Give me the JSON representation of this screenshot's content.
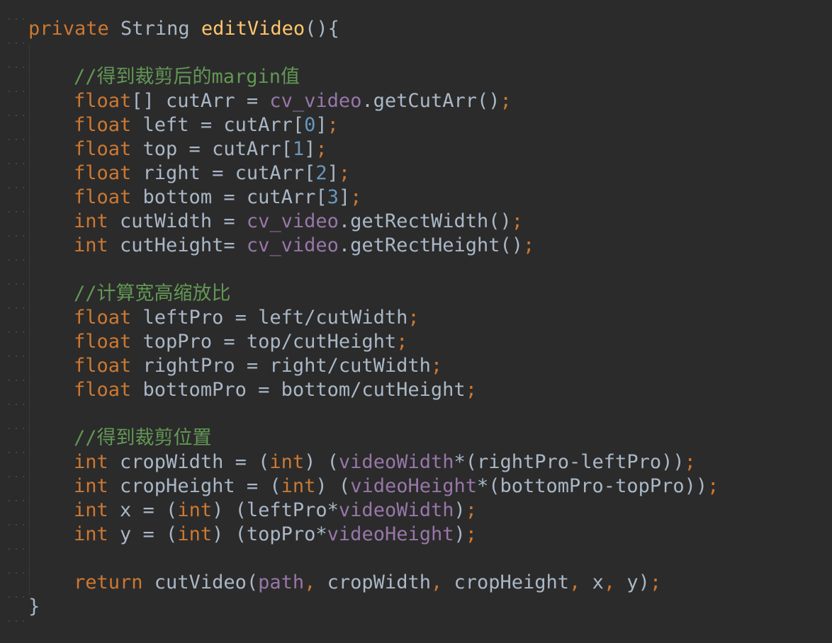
{
  "code_lines": [
    {
      "indent": 0,
      "tokens": [
        [
          "kw",
          "private"
        ],
        [
          "pl",
          " String "
        ],
        [
          "fn",
          "editVideo"
        ],
        [
          "pl",
          "(){"
        ]
      ]
    },
    {
      "indent": 0,
      "tokens": []
    },
    {
      "indent": 1,
      "tokens": [
        [
          "cm",
          "//得到裁剪后的margin值"
        ]
      ]
    },
    {
      "indent": 1,
      "tokens": [
        [
          "kw",
          "float"
        ],
        [
          "pl",
          "[] cutArr = "
        ],
        [
          "fd",
          "cv_video"
        ],
        [
          "pl",
          ".getCutArr()"
        ],
        [
          "kw",
          ";"
        ]
      ]
    },
    {
      "indent": 1,
      "tokens": [
        [
          "kw",
          "float"
        ],
        [
          "pl",
          " left = cutArr["
        ],
        [
          "nm",
          "0"
        ],
        [
          "pl",
          "]"
        ],
        [
          "kw",
          ";"
        ]
      ]
    },
    {
      "indent": 1,
      "tokens": [
        [
          "kw",
          "float"
        ],
        [
          "pl",
          " top = cutArr["
        ],
        [
          "nm",
          "1"
        ],
        [
          "pl",
          "]"
        ],
        [
          "kw",
          ";"
        ]
      ]
    },
    {
      "indent": 1,
      "tokens": [
        [
          "kw",
          "float"
        ],
        [
          "pl",
          " right = cutArr["
        ],
        [
          "nm",
          "2"
        ],
        [
          "pl",
          "]"
        ],
        [
          "kw",
          ";"
        ]
      ]
    },
    {
      "indent": 1,
      "tokens": [
        [
          "kw",
          "float"
        ],
        [
          "pl",
          " bottom = cutArr["
        ],
        [
          "nm",
          "3"
        ],
        [
          "pl",
          "]"
        ],
        [
          "kw",
          ";"
        ]
      ]
    },
    {
      "indent": 1,
      "tokens": [
        [
          "kw",
          "int"
        ],
        [
          "pl",
          " cutWidth = "
        ],
        [
          "fd",
          "cv_video"
        ],
        [
          "pl",
          ".getRectWidth()"
        ],
        [
          "kw",
          ";"
        ]
      ]
    },
    {
      "indent": 1,
      "tokens": [
        [
          "kw",
          "int"
        ],
        [
          "pl",
          " cutHeight= "
        ],
        [
          "fd",
          "cv_video"
        ],
        [
          "pl",
          ".getRectHeight()"
        ],
        [
          "kw",
          ";"
        ]
      ]
    },
    {
      "indent": 0,
      "tokens": []
    },
    {
      "indent": 1,
      "tokens": [
        [
          "cm",
          "//计算宽高缩放比"
        ]
      ]
    },
    {
      "indent": 1,
      "tokens": [
        [
          "kw",
          "float"
        ],
        [
          "pl",
          " leftPro = left/cutWidth"
        ],
        [
          "kw",
          ";"
        ]
      ]
    },
    {
      "indent": 1,
      "tokens": [
        [
          "kw",
          "float"
        ],
        [
          "pl",
          " topPro = top/cutHeight"
        ],
        [
          "kw",
          ";"
        ]
      ]
    },
    {
      "indent": 1,
      "tokens": [
        [
          "kw",
          "float"
        ],
        [
          "pl",
          " rightPro = right/cutWidth"
        ],
        [
          "kw",
          ";"
        ]
      ]
    },
    {
      "indent": 1,
      "tokens": [
        [
          "kw",
          "float"
        ],
        [
          "pl",
          " bottomPro = bottom/cutHeight"
        ],
        [
          "kw",
          ";"
        ]
      ]
    },
    {
      "indent": 0,
      "tokens": []
    },
    {
      "indent": 1,
      "tokens": [
        [
          "cm",
          "//得到裁剪位置"
        ]
      ]
    },
    {
      "indent": 1,
      "tokens": [
        [
          "kw",
          "int"
        ],
        [
          "pl",
          " cropWidth = ("
        ],
        [
          "kw",
          "int"
        ],
        [
          "pl",
          ") ("
        ],
        [
          "fd",
          "videoWidth"
        ],
        [
          "pl",
          "*(rightPro-leftPro))"
        ],
        [
          "kw",
          ";"
        ]
      ]
    },
    {
      "indent": 1,
      "tokens": [
        [
          "kw",
          "int"
        ],
        [
          "pl",
          " cropHeight = ("
        ],
        [
          "kw",
          "int"
        ],
        [
          "pl",
          ") ("
        ],
        [
          "fd",
          "videoHeight"
        ],
        [
          "pl",
          "*(bottomPro-topPro))"
        ],
        [
          "kw",
          ";"
        ]
      ]
    },
    {
      "indent": 1,
      "tokens": [
        [
          "kw",
          "int"
        ],
        [
          "pl",
          " x = ("
        ],
        [
          "kw",
          "int"
        ],
        [
          "pl",
          ") (leftPro*"
        ],
        [
          "fd",
          "videoWidth"
        ],
        [
          "pl",
          ")"
        ],
        [
          "kw",
          ";"
        ]
      ]
    },
    {
      "indent": 1,
      "tokens": [
        [
          "kw",
          "int"
        ],
        [
          "pl",
          " y = ("
        ],
        [
          "kw",
          "int"
        ],
        [
          "pl",
          ") (topPro*"
        ],
        [
          "fd",
          "videoHeight"
        ],
        [
          "pl",
          ")"
        ],
        [
          "kw",
          ";"
        ]
      ]
    },
    {
      "indent": 0,
      "tokens": []
    },
    {
      "indent": 1,
      "tokens": [
        [
          "kw",
          "return"
        ],
        [
          "pl",
          " cutVideo("
        ],
        [
          "fd",
          "path"
        ],
        [
          "kw",
          ", "
        ],
        [
          "pl",
          "cropWidth"
        ],
        [
          "kw",
          ", "
        ],
        [
          "pl",
          "cropHeight"
        ],
        [
          "kw",
          ", "
        ],
        [
          "pl",
          "x"
        ],
        [
          "kw",
          ", "
        ],
        [
          "pl",
          "y)"
        ],
        [
          "kw",
          ";"
        ]
      ]
    },
    {
      "indent": 0,
      "tokens": [
        [
          "pl",
          "}"
        ]
      ]
    }
  ],
  "colors": {
    "background": "#2b2b2b",
    "keyword": "#cc7832",
    "function": "#ffc66d",
    "comment": "#629755",
    "field": "#9876aa",
    "number": "#6897bb",
    "plain": "#a9b7c6"
  }
}
